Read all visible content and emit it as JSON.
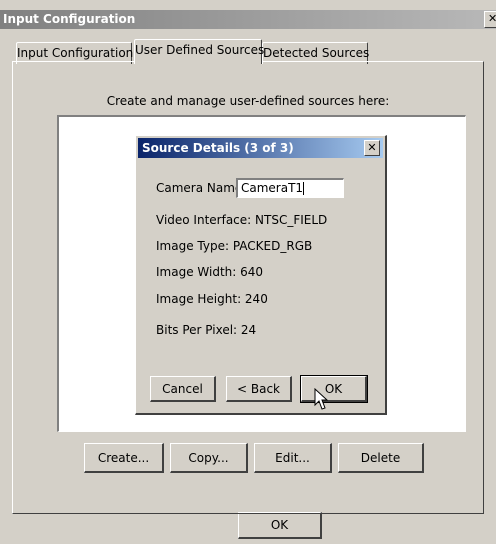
{
  "window": {
    "title": "Input Configuration",
    "close_glyph": "✕"
  },
  "tabs": [
    {
      "label": "Input Configuration"
    },
    {
      "label": "User Defined Sources",
      "active": true
    },
    {
      "label": "Detected Sources"
    }
  ],
  "panel": {
    "instruction": "Create and manage user-defined sources here:",
    "buttons": {
      "create": "Create...",
      "copy": "Copy...",
      "edit": "Edit...",
      "delete": "Delete"
    }
  },
  "ok_label": "OK",
  "dialog": {
    "title": "Source Details (3 of 3)",
    "close_glyph": "✕",
    "camera_name_label": "Camera Name:",
    "camera_name_value": "CameraT1",
    "details": [
      "Video Interface: NTSC_FIELD",
      "Image Type: PACKED_RGB",
      "Image Width: 640",
      "Image Height: 240",
      "Bits Per Pixel: 24"
    ],
    "buttons": {
      "cancel": "Cancel",
      "back": "< Back",
      "ok": "OK"
    }
  },
  "icons": {
    "window_close": "close-icon",
    "dialog_close": "close-icon",
    "pointer": "mouse-pointer-icon"
  },
  "colors": {
    "dialog_titlebar": "#0a246a",
    "window_face": "#d4d0c8",
    "inactive_titlebar": "#808080"
  }
}
